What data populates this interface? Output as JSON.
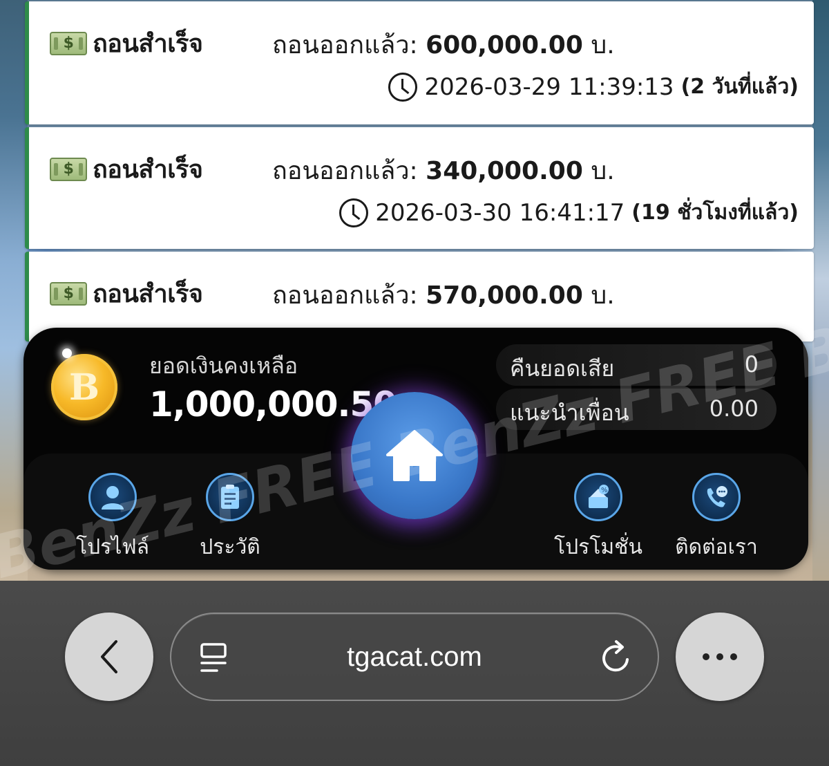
{
  "transactions": [
    {
      "status": "ถอนสำเร็จ",
      "amount_label": "ถอนออกแล้ว:",
      "amount": "600,000.00",
      "currency": "บ.",
      "datetime": "2026-03-29 11:39:13",
      "relative": "(2 วันที่แล้ว)"
    },
    {
      "status": "ถอนสำเร็จ",
      "amount_label": "ถอนออกแล้ว:",
      "amount": "340,000.00",
      "currency": "บ.",
      "datetime": "2026-03-30 16:41:17",
      "relative": "(19 ชั่วโมงที่แล้ว)"
    },
    {
      "status": "ถอนสำเร็จ",
      "amount_label": "ถอนออกแล้ว:",
      "amount": "570,000.00",
      "currency": "บ.",
      "datetime": "",
      "relative": ""
    }
  ],
  "wallet": {
    "balance_label": "ยอดเงินคงเหลือ",
    "balance": "1,000,000.50",
    "cashback_label": "คืนยอดเสีย",
    "cashback_value": "0",
    "referral_label": "แนะนำเพื่อน",
    "referral_value": "0.00"
  },
  "nav": {
    "profile": "โปรไฟล์",
    "history": "ประวัติ",
    "promotion": "โปรโมชั่น",
    "contact": "ติดต่อเรา"
  },
  "browser": {
    "url": "tgacat.com"
  },
  "watermark": "BenZz FREE BenZz FREE BenZz",
  "colors": {
    "card_accent": "#2e8b4a",
    "home_button": "#3a78c9",
    "nav_icon_ring": "#5aa6e8"
  }
}
